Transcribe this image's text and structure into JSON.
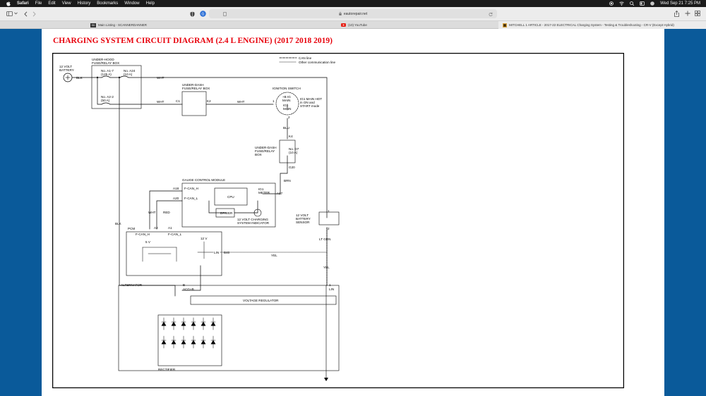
{
  "menubar": {
    "apple": "",
    "app_name": "Safari",
    "items": [
      "File",
      "Edit",
      "View",
      "History",
      "Bookmarks",
      "Window",
      "Help"
    ],
    "clock": "Wed Sep 21  7:25 PM"
  },
  "browser": {
    "url": "eautorepair.net",
    "tabs": [
      {
        "title": "Main Listing - SCANNERDANNER",
        "favicon": "SD"
      },
      {
        "title": "(10) YouTube",
        "favicon": "youtube"
      },
      {
        "title": "MITCHELL 1 ARTICLE - 2017-22 ELECTRICAL Charging System - Testing & Troubleshooting - CR-V (Except Hybrid)",
        "favicon": "mitchell"
      }
    ]
  },
  "page": {
    "title": "CHARGING SYSTEM CIRCUIT DIAGRAM (2.4 L ENGINE) (2017 2018 2019)"
  },
  "diagram": {
    "legend": {
      "can_line": "CAN line",
      "other_line": "Other communication line"
    },
    "labels": {
      "battery": [
        "12 VOLT",
        "BATTERY"
      ],
      "underhood_box": [
        "UNDER-HOOD",
        "FUSE/RELAY BOX"
      ],
      "fuse_a17": [
        "No. A1-7",
        "(125 A)"
      ],
      "fuse_a24": [
        "No. A24",
        "(10 A)"
      ],
      "fuse_a22": [
        "No. A2-2",
        "(50 A)"
      ],
      "underdash_box": [
        "UNDER-DASH",
        "FUSE/RELAY BOX"
      ],
      "ignition_switch": "IGNITION SWITCH",
      "ig1_main_hot": [
        "IG1 MAIN HOT",
        "in ON and",
        "START mode"
      ],
      "fuse_d7": [
        "No. D7",
        "(10 A)"
      ],
      "underdash_box2": [
        "UNDER-DASH",
        "FUSE/RELAY",
        "BOX"
      ],
      "gauge_module": "GAUGE CONTROL MODULE",
      "cpu": "CPU",
      "driver": "DRIVER",
      "ig1_meter": [
        "IG1",
        "METER"
      ],
      "indicator": [
        "12 VOLT CHARGING",
        "SYSTEM INDICATOR"
      ],
      "battery_sensor": [
        "12 VOLT",
        "BATTERY",
        "SENSOR"
      ],
      "pcm": "PCM",
      "alternator": "ALTERNATOR",
      "voltage_regulator": "VOLTAGE REGULATOR",
      "rectifier": "RECTIFIER",
      "wire_blk": "BLK",
      "wire_wht": "WHT",
      "wire_blu": "BLU",
      "wire_brn": "BRN",
      "wire_red": "RED",
      "wire_yel": "YEL",
      "wire_ltgrn": "LT GRN",
      "conn_c1": "C1",
      "conn_k2": "K2",
      "conn_k4": "K4",
      "conn_g20": "G20",
      "conn_a18": "A18",
      "conn_a20": "A20",
      "conn_a17": "A17",
      "conn_a2": "A2",
      "conn_a1": "A1",
      "conn_b40": "B40",
      "conn_b": "B",
      "conn_lin": "LIN",
      "pin_1": "1",
      "pin_2": "2",
      "fcan_h": "F-CAN_H",
      "fcan_l": "F-CAN_L",
      "v5": "5 V",
      "v12": "12 V",
      "acg_b": "ACG+B",
      "plus_b_ig1": [
        "+B IG",
        "MAIN"
      ],
      "ig1_main": [
        "IG1",
        "MAIN"
      ]
    }
  }
}
